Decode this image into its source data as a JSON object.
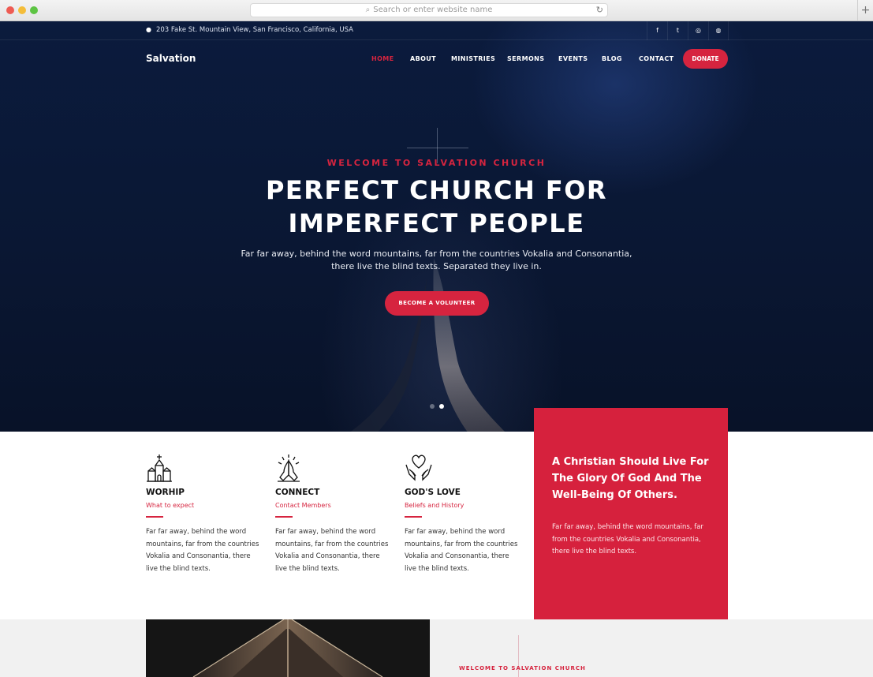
{
  "browser": {
    "address_placeholder": "Search or enter website name"
  },
  "topbar": {
    "address": "203 Fake St. Mountain View, San Francisco, California, USA",
    "social": [
      "facebook-icon",
      "twitter-icon",
      "instagram-icon",
      "dribbble-icon"
    ]
  },
  "nav": {
    "logo": "Salvation",
    "links": [
      "HOME",
      "ABOUT",
      "MINISTRIES",
      "SERMONS",
      "EVENTS",
      "BLOG",
      "CONTACT"
    ],
    "active": "HOME",
    "donate": "DONATE"
  },
  "hero": {
    "eyebrow": "WELCOME TO SALVATION CHURCH",
    "headline_line1": "PERFECT CHURCH FOR",
    "headline_line2": "IMPERFECT PEOPLE",
    "sub_line1": "Far far away, behind the word mountains, far from the countries Vokalia and Consonantia,",
    "sub_line2": "there live the blind texts. Separated they live in.",
    "cta": "BECOME A VOLUNTEER",
    "slides": 2,
    "active_slide": 2
  },
  "features": [
    {
      "icon": "church-icon",
      "title": "WORHIP",
      "subtitle": "What to expect",
      "text": "Far far away, behind the word mountains, far from the countries Vokalia and Consonantia, there live the blind texts."
    },
    {
      "icon": "praying-hands-icon",
      "title": "CONNECT",
      "subtitle": "Contact Members",
      "text": "Far far away, behind the word mountains, far from the countries Vokalia and Consonantia, there live the blind texts."
    },
    {
      "icon": "heart-hands-icon",
      "title": "GOD'S LOVE",
      "subtitle": "Beliefs and History",
      "text": "Far far away, behind the word mountains, far from the countries Vokalia and Consonantia, there live the blind texts."
    }
  ],
  "callout": {
    "title": "A Christian Should Live For The Glory Of God And The Well-Being Of Others.",
    "text": "Far far away, behind the word mountains, far from the countries Vokalia and Consonantia, there live the blind texts."
  },
  "section2": {
    "eyebrow": "WELCOME TO SALVATION CHURCH"
  },
  "colors": {
    "accent": "#d6243f",
    "hero_bg": "#0a1733"
  }
}
